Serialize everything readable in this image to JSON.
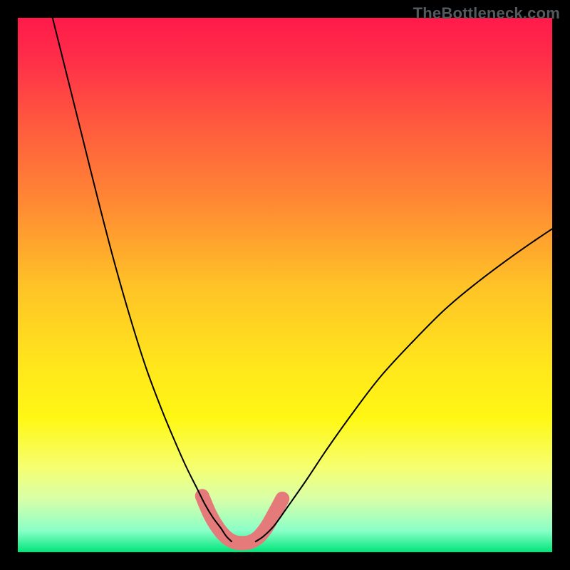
{
  "watermark": "TheBottleneck.com",
  "chart_data": {
    "type": "line",
    "title": "",
    "xlabel": "",
    "ylabel": "",
    "xlim": [
      0,
      100
    ],
    "ylim": [
      0,
      100
    ],
    "grid": false,
    "legend": false,
    "background_gradient": {
      "stops": [
        {
          "offset": 0.0,
          "color": "#ff1a4b"
        },
        {
          "offset": 0.08,
          "color": "#ff2f49"
        },
        {
          "offset": 0.2,
          "color": "#ff5a3e"
        },
        {
          "offset": 0.35,
          "color": "#ff8a33"
        },
        {
          "offset": 0.5,
          "color": "#ffc227"
        },
        {
          "offset": 0.65,
          "color": "#ffe61c"
        },
        {
          "offset": 0.75,
          "color": "#fff714"
        },
        {
          "offset": 0.84,
          "color": "#f6ff6e"
        },
        {
          "offset": 0.9,
          "color": "#d9ffa8"
        },
        {
          "offset": 0.96,
          "color": "#8affc8"
        },
        {
          "offset": 1.0,
          "color": "#00e57a"
        }
      ]
    },
    "series": [
      {
        "name": "left-branch",
        "type": "curve",
        "stroke": "#000000",
        "stroke_width": 2,
        "points": [
          {
            "x": 6.5,
            "y": 100.0
          },
          {
            "x": 9.0,
            "y": 90.0
          },
          {
            "x": 12.0,
            "y": 78.0
          },
          {
            "x": 15.0,
            "y": 66.0
          },
          {
            "x": 18.0,
            "y": 54.5
          },
          {
            "x": 21.0,
            "y": 44.0
          },
          {
            "x": 24.0,
            "y": 34.5
          },
          {
            "x": 27.0,
            "y": 26.5
          },
          {
            "x": 29.5,
            "y": 20.5
          },
          {
            "x": 31.5,
            "y": 16.0
          },
          {
            "x": 33.5,
            "y": 12.0
          },
          {
            "x": 35.0,
            "y": 9.0
          },
          {
            "x": 36.5,
            "y": 6.5
          },
          {
            "x": 38.0,
            "y": 4.5
          },
          {
            "x": 39.0,
            "y": 3.0
          },
          {
            "x": 40.0,
            "y": 2.0
          }
        ]
      },
      {
        "name": "right-branch",
        "type": "curve",
        "stroke": "#000000",
        "stroke_width": 2,
        "points": [
          {
            "x": 44.5,
            "y": 2.0
          },
          {
            "x": 46.0,
            "y": 3.0
          },
          {
            "x": 48.0,
            "y": 5.0
          },
          {
            "x": 50.5,
            "y": 8.5
          },
          {
            "x": 54.0,
            "y": 13.5
          },
          {
            "x": 58.0,
            "y": 19.5
          },
          {
            "x": 63.0,
            "y": 26.5
          },
          {
            "x": 68.0,
            "y": 33.0
          },
          {
            "x": 74.0,
            "y": 39.5
          },
          {
            "x": 80.0,
            "y": 45.5
          },
          {
            "x": 86.0,
            "y": 50.5
          },
          {
            "x": 92.0,
            "y": 55.0
          },
          {
            "x": 97.0,
            "y": 58.5
          },
          {
            "x": 100.0,
            "y": 60.5
          }
        ]
      },
      {
        "name": "highlight-band",
        "type": "thick-curve",
        "stroke": "#e47a7a",
        "stroke_width": 20,
        "points": [
          {
            "x": 34.5,
            "y": 10.5
          },
          {
            "x": 36.0,
            "y": 7.0
          },
          {
            "x": 37.5,
            "y": 4.5
          },
          {
            "x": 39.0,
            "y": 2.8
          },
          {
            "x": 40.5,
            "y": 1.9
          },
          {
            "x": 42.0,
            "y": 1.7
          },
          {
            "x": 43.5,
            "y": 1.9
          },
          {
            "x": 45.0,
            "y": 2.8
          },
          {
            "x": 46.5,
            "y": 4.6
          },
          {
            "x": 48.0,
            "y": 7.2
          },
          {
            "x": 49.5,
            "y": 10.0
          }
        ]
      }
    ]
  }
}
